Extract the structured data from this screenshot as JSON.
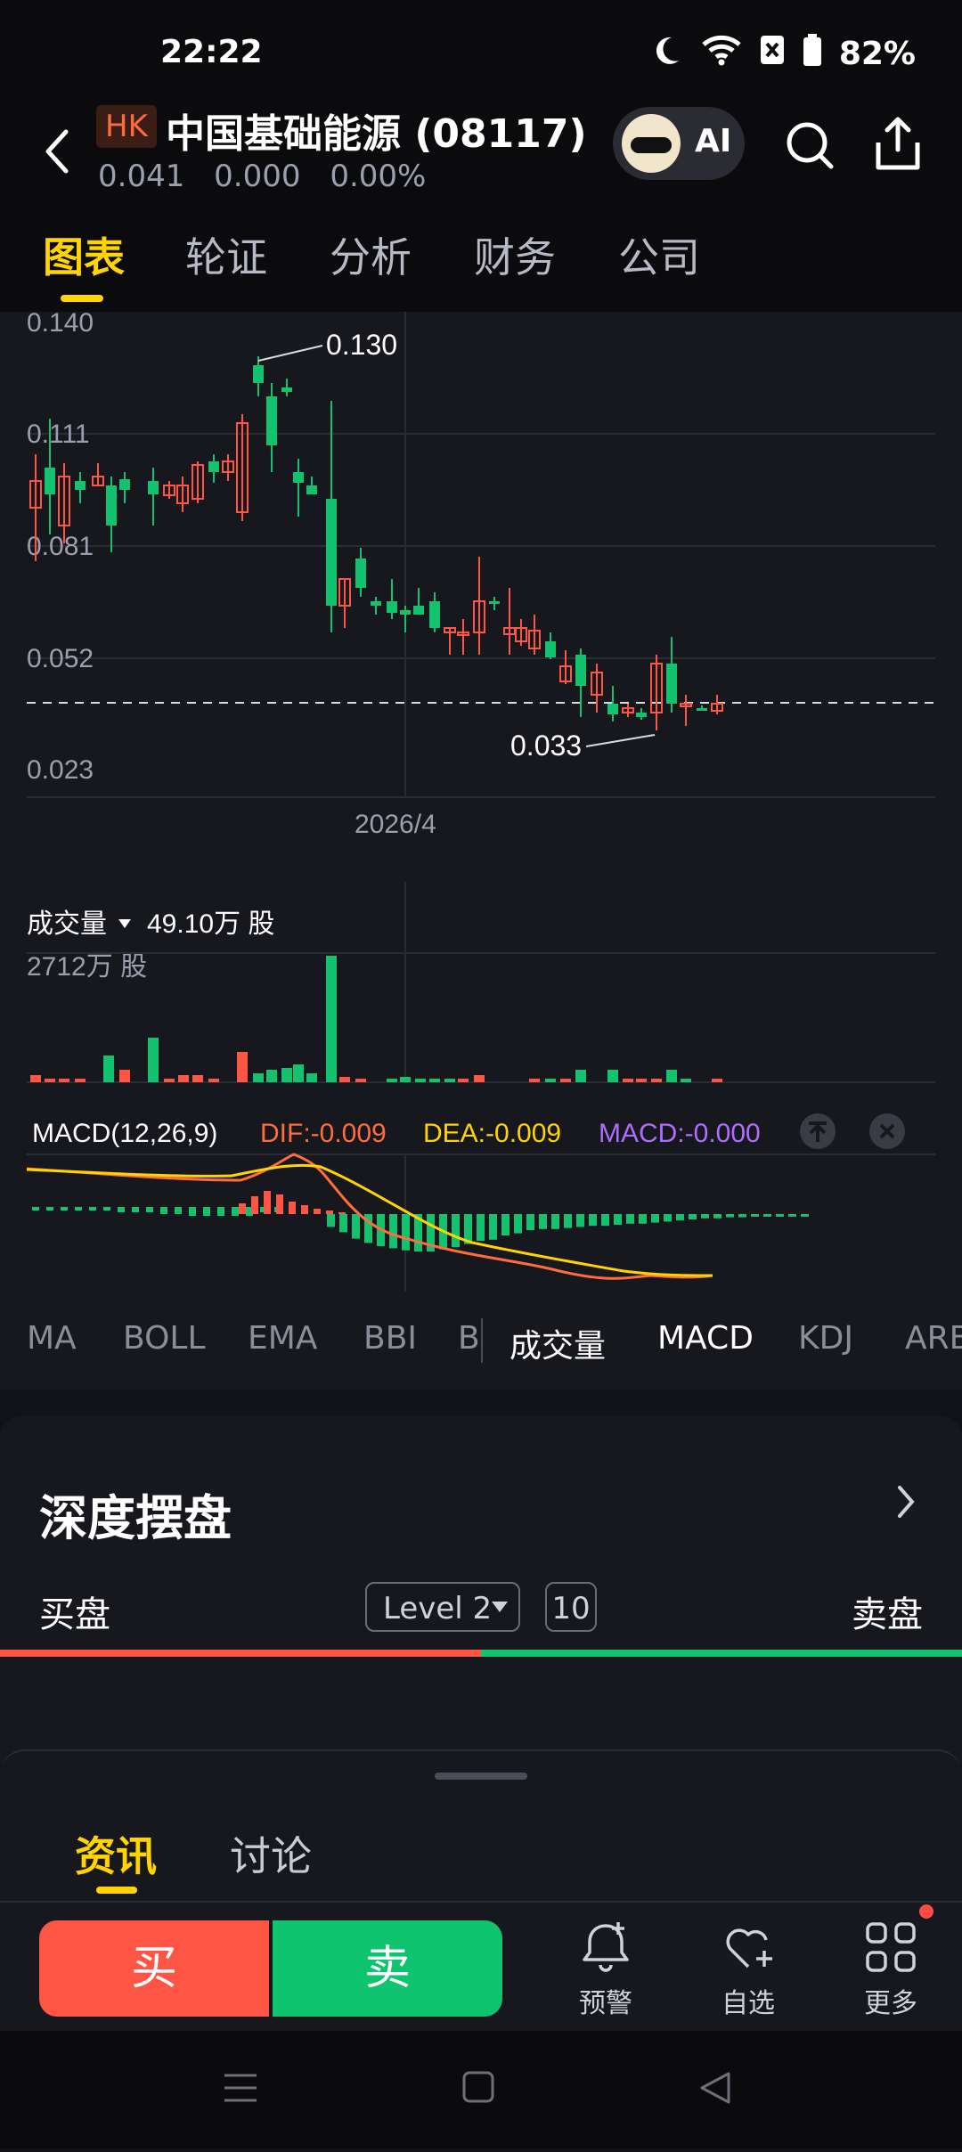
{
  "status_bar": {
    "time": "22:22",
    "battery": "82%"
  },
  "header": {
    "market_badge": "HK",
    "stock_name": "中国基础能源 (08117)",
    "price": "0.041",
    "change": "0.000",
    "change_pct": "0.00%",
    "ai_label": "AI"
  },
  "tabs": [
    "图表",
    "轮证",
    "分析",
    "财务",
    "公司"
  ],
  "chart": {
    "y_ticks": [
      "0.140",
      "0.111",
      "0.081",
      "0.052",
      "0.023"
    ],
    "x_label": "2026/4",
    "high_label": "0.130",
    "low_label": "0.033",
    "volume_title": "成交量",
    "volume_value": "49.10万 股",
    "volume_max": "2712万 股",
    "macd_title": "MACD(12,26,9)",
    "dif": "DIF:-0.009",
    "dea": "DEA:-0.009",
    "macd": "MACD:-0.000"
  },
  "indicator_tabs": [
    "MA",
    "BOLL",
    "EMA",
    "BBI",
    "B",
    "成交量",
    "MACD",
    "KDJ",
    "ARB"
  ],
  "depth": {
    "title": "深度摆盘",
    "buy_label": "买盘",
    "sell_label": "卖盘",
    "level": "Level 2",
    "count": "10"
  },
  "news_tabs": [
    "资讯",
    "讨论"
  ],
  "actions": {
    "buy": "买",
    "sell": "卖",
    "alert": "预警",
    "watchlist": "自选",
    "more": "更多"
  },
  "colors": {
    "accent": "#ffd400",
    "up": "#ff5545",
    "down": "#12c26e"
  }
}
